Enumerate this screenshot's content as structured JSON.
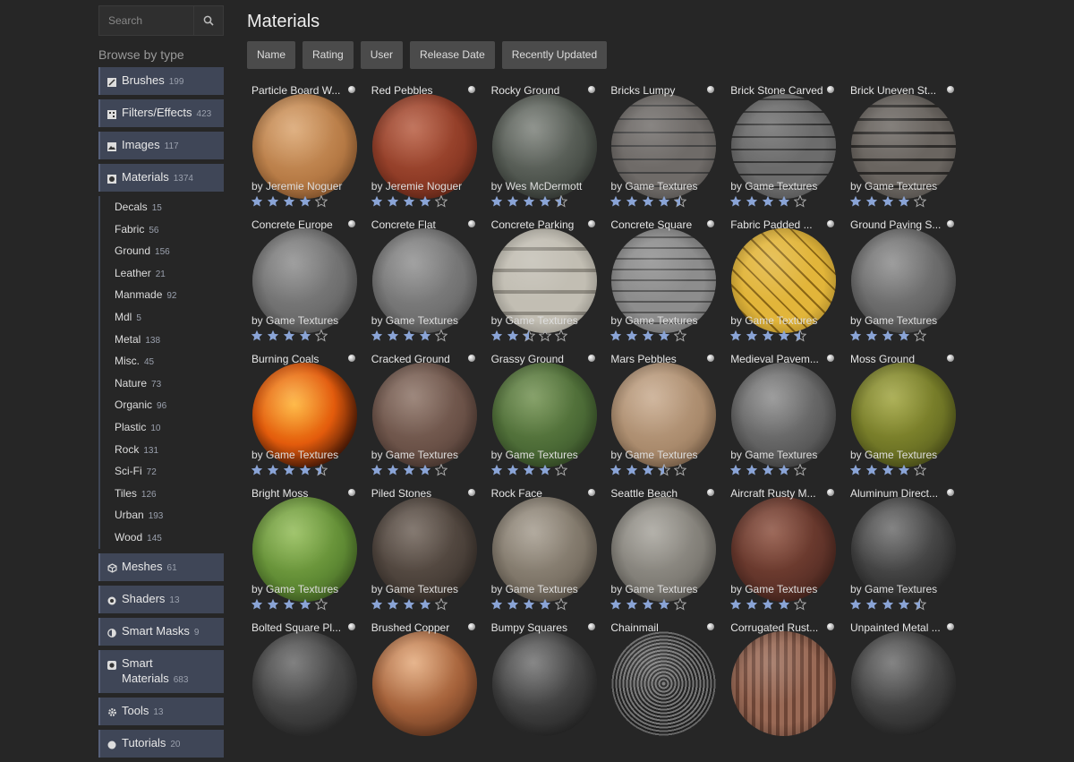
{
  "search": {
    "placeholder": "Search"
  },
  "browse_label": "Browse by type",
  "sidebar": {
    "categories_top": [
      {
        "label": "Brushes",
        "count": "199",
        "icon": "brush-icon"
      },
      {
        "label": "Filters/Effects",
        "count": "423",
        "icon": "filter-icon"
      },
      {
        "label": "Images",
        "count": "117",
        "icon": "image-icon"
      },
      {
        "label": "Materials",
        "count": "1374",
        "icon": "material-ball-icon"
      }
    ],
    "material_subtypes": [
      {
        "label": "Decals",
        "count": "15"
      },
      {
        "label": "Fabric",
        "count": "56"
      },
      {
        "label": "Ground",
        "count": "156"
      },
      {
        "label": "Leather",
        "count": "21"
      },
      {
        "label": "Manmade",
        "count": "92"
      },
      {
        "label": "Mdl",
        "count": "5"
      },
      {
        "label": "Metal",
        "count": "138"
      },
      {
        "label": "Misc.",
        "count": "45"
      },
      {
        "label": "Nature",
        "count": "73"
      },
      {
        "label": "Organic",
        "count": "96"
      },
      {
        "label": "Plastic",
        "count": "10"
      },
      {
        "label": "Rock",
        "count": "131"
      },
      {
        "label": "Sci-Fi",
        "count": "72"
      },
      {
        "label": "Tiles",
        "count": "126"
      },
      {
        "label": "Urban",
        "count": "193"
      },
      {
        "label": "Wood",
        "count": "145"
      }
    ],
    "categories_bottom": [
      {
        "label": "Meshes",
        "count": "61",
        "icon": "mesh-cube-icon"
      },
      {
        "label": "Shaders",
        "count": "13",
        "icon": "shader-icon"
      },
      {
        "label": "Smart Masks",
        "count": "9",
        "icon": "smart-mask-icon"
      },
      {
        "label": "Smart Materials",
        "count": "683",
        "icon": "smart-material-icon"
      },
      {
        "label": "Tools",
        "count": "13",
        "icon": "gear-icon"
      },
      {
        "label": "Tutorials",
        "count": "20",
        "icon": "help-icon"
      }
    ]
  },
  "page_title": "Materials",
  "sort_buttons": [
    "Name",
    "Rating",
    "User",
    "Release Date",
    "Recently Updated"
  ],
  "colors": {
    "accent": "#3f4657",
    "star": "#8aa4d6",
    "background": "#262626"
  },
  "materials": [
    {
      "name": "Particle Board W...",
      "author": "by Jeremie Noguer",
      "rating": 4,
      "look": "particle"
    },
    {
      "name": "Red Pebbles",
      "author": "by Jeremie Noguer",
      "rating": 4,
      "look": "redpebble"
    },
    {
      "name": "Rocky Ground",
      "author": "by Wes McDermott",
      "rating": 4.5,
      "look": "rocky"
    },
    {
      "name": "Bricks Lumpy",
      "author": "by Game Textures",
      "rating": 4.5,
      "look": "bricks"
    },
    {
      "name": "Brick Stone Carved",
      "author": "by Game Textures",
      "rating": 4,
      "look": "brickstone"
    },
    {
      "name": "Brick Uneven St...",
      "author": "by Game Textures",
      "rating": 4,
      "look": "brickuneven"
    },
    {
      "name": "Concrete Europe",
      "author": "by Game Textures",
      "rating": 4,
      "look": "concrete"
    },
    {
      "name": "Concrete Flat",
      "author": "by Game Textures",
      "rating": 4,
      "look": "concreteflat"
    },
    {
      "name": "Concrete Parking",
      "author": "by Game Textures",
      "rating": 2.5,
      "look": "parking"
    },
    {
      "name": "Concrete Square",
      "author": "by Game Textures",
      "rating": 4,
      "look": "squares"
    },
    {
      "name": "Fabric Padded ...",
      "author": "by Game Textures",
      "rating": 4.5,
      "look": "gold"
    },
    {
      "name": "Ground Paving S...",
      "author": "by Game Textures",
      "rating": 4,
      "look": "paving"
    },
    {
      "name": "Burning Coals",
      "author": "by Game Textures",
      "rating": 4.5,
      "look": "coals"
    },
    {
      "name": "Cracked Ground",
      "author": "by Game Textures",
      "rating": 4,
      "look": "cracked"
    },
    {
      "name": "Grassy Ground",
      "author": "by Game Textures",
      "rating": 4,
      "look": "grassy"
    },
    {
      "name": "Mars Pebbles",
      "author": "by Game Textures",
      "rating": 3.5,
      "look": "mars"
    },
    {
      "name": "Medieval Pavem...",
      "author": "by Game Textures",
      "rating": 4,
      "look": "medieval"
    },
    {
      "name": "Moss Ground",
      "author": "by Game Textures",
      "rating": 4,
      "look": "moss"
    },
    {
      "name": "Bright Moss",
      "author": "by Game Textures",
      "rating": 4,
      "look": "brightmoss"
    },
    {
      "name": "Piled Stones",
      "author": "by Game Textures",
      "rating": 4,
      "look": "piled"
    },
    {
      "name": "Rock Face",
      "author": "by Game Textures",
      "rating": 4,
      "look": "rockface"
    },
    {
      "name": "Seattle Beach",
      "author": "by Game Textures",
      "rating": 4,
      "look": "beach"
    },
    {
      "name": "Aircraft Rusty M...",
      "author": "by Game Textures",
      "rating": 4,
      "look": "rusty"
    },
    {
      "name": "Aluminum Direct...",
      "author": "by Game Textures",
      "rating": 4.5,
      "look": "aluminum"
    },
    {
      "name": "Bolted Square Pl...",
      "author": "",
      "rating": 0,
      "look": "bolted"
    },
    {
      "name": "Brushed Copper",
      "author": "",
      "rating": 0,
      "look": "copper"
    },
    {
      "name": "Bumpy Squares",
      "author": "",
      "rating": 0,
      "look": "bumpy"
    },
    {
      "name": "Chainmail",
      "author": "",
      "rating": 0,
      "look": "chainmail"
    },
    {
      "name": "Corrugated Rust...",
      "author": "",
      "rating": 0,
      "look": "corrugated"
    },
    {
      "name": "Unpainted Metal ...",
      "author": "",
      "rating": 0,
      "look": "unpainted"
    }
  ]
}
